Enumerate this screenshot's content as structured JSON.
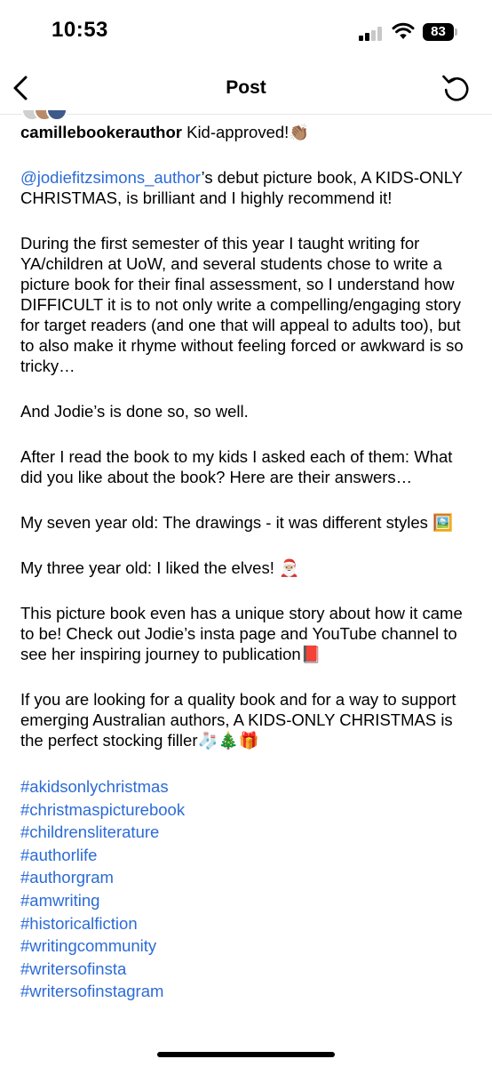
{
  "status_bar": {
    "time": "10:53",
    "battery": "83"
  },
  "nav": {
    "title": "Post",
    "back_icon": "chevron-left-icon",
    "refresh_icon": "refresh-icon"
  },
  "post": {
    "username": "camillebookerauthor",
    "headline": " Kid-approved!👏🏽",
    "mention": "@jodiefitzsimons_author",
    "p1_rest": "’s debut picture book, A KIDS-ONLY CHRISTMAS, is brilliant and I highly recommend it!",
    "p2": "During the first semester of this year I taught writing for YA/children at UoW, and several students chose to write a picture book for their final assessment, so I understand how DIFFICULT it is to not only write a compelling/engaging story for target readers (and one that will appeal to adults too), but to also make it rhyme without feeling forced or awkward is so tricky…",
    "p3": "And Jodie’s is done so, so well.",
    "p4": "After I read the book to my kids I asked each of them: What did you like about the book? Here are their answers…",
    "p5": "My seven year old: The drawings - it was different styles 🖼️",
    "p6": "My three year old: I liked the elves! 🎅🏼",
    "p7": "This picture book even has a unique story about how it came to be! Check out Jodie’s insta page and YouTube channel to see her inspiring journey to publication📕",
    "p8": "If you are looking for a quality book and for a way to support emerging Australian authors, A KIDS-ONLY CHRISTMAS is the perfect stocking filler🧦🎄🎁",
    "hashtags": [
      "#akidsonlychristmas",
      "#christmaspicturebook",
      "#childrensliterature",
      "#authorlife",
      "#authorgram",
      "#amwriting",
      "#historicalfiction",
      "#writingcommunity",
      "#writersofinsta",
      "#writersofinstagram"
    ]
  }
}
